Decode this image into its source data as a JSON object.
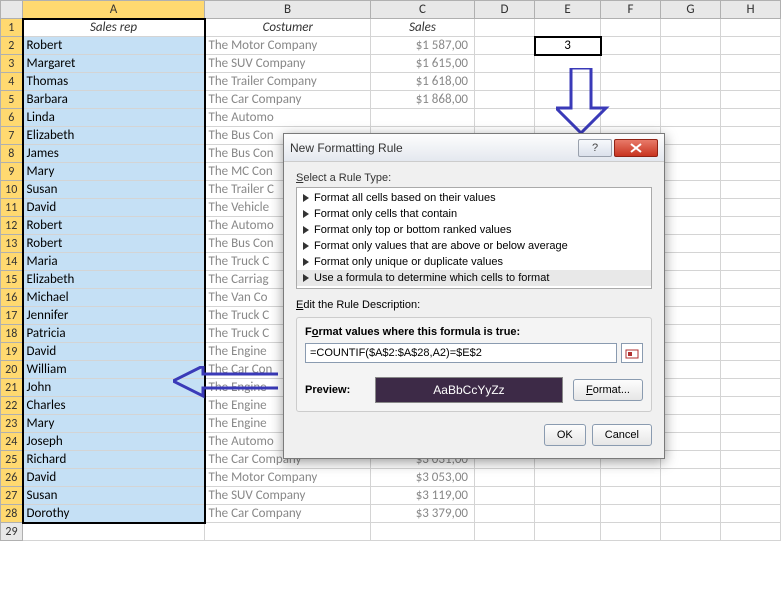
{
  "columns": [
    "A",
    "B",
    "C",
    "D",
    "E",
    "F",
    "G",
    "H"
  ],
  "headerRow": {
    "A": "Sales rep",
    "B": "Costumer",
    "C": "Sales"
  },
  "e2": "3",
  "rows": [
    {
      "n": 2,
      "A": "Robert",
      "B": "The Motor Company",
      "C": "$1 587,00"
    },
    {
      "n": 3,
      "A": "Margaret",
      "B": "The SUV Company",
      "C": "$1 615,00"
    },
    {
      "n": 4,
      "A": "Thomas",
      "B": "The Trailer Company",
      "C": "$1 618,00"
    },
    {
      "n": 5,
      "A": "Barbara",
      "B": "The Car Company",
      "C": "$1 868,00"
    },
    {
      "n": 6,
      "A": "Linda",
      "B": "The Automo",
      "C": ""
    },
    {
      "n": 7,
      "A": "Elizabeth",
      "B": "The Bus Con",
      "C": ""
    },
    {
      "n": 8,
      "A": "James",
      "B": "The Bus Con",
      "C": ""
    },
    {
      "n": 9,
      "A": "Mary",
      "B": "The MC Con",
      "C": ""
    },
    {
      "n": 10,
      "A": "Susan",
      "B": "The Trailer C",
      "C": ""
    },
    {
      "n": 11,
      "A": "David",
      "B": "The Vehicle",
      "C": ""
    },
    {
      "n": 12,
      "A": "Robert",
      "B": "The Automo",
      "C": ""
    },
    {
      "n": 13,
      "A": "Robert",
      "B": "The Bus Con",
      "C": ""
    },
    {
      "n": 14,
      "A": "Maria",
      "B": "The Truck C",
      "C": ""
    },
    {
      "n": 15,
      "A": "Elizabeth",
      "B": "The Carriag",
      "C": ""
    },
    {
      "n": 16,
      "A": "Michael",
      "B": "The Van Co",
      "C": ""
    },
    {
      "n": 17,
      "A": "Jennifer",
      "B": "The Truck C",
      "C": ""
    },
    {
      "n": 18,
      "A": "Patricia",
      "B": "The Truck C",
      "C": ""
    },
    {
      "n": 19,
      "A": "David",
      "B": "The Engine",
      "C": ""
    },
    {
      "n": 20,
      "A": "William",
      "B": "The Car Con",
      "C": ""
    },
    {
      "n": 21,
      "A": "John",
      "B": "The Engine",
      "C": ""
    },
    {
      "n": 22,
      "A": "Charles",
      "B": "The Engine",
      "C": ""
    },
    {
      "n": 23,
      "A": "Mary",
      "B": "The Engine",
      "C": ""
    },
    {
      "n": 24,
      "A": "Joseph",
      "B": "The Automo",
      "C": ""
    },
    {
      "n": 25,
      "A": "Richard",
      "B": "The Car Company",
      "C": "$3 031,00"
    },
    {
      "n": 26,
      "A": "David",
      "B": "The Motor Company",
      "C": "$3 053,00"
    },
    {
      "n": 27,
      "A": "Susan",
      "B": "The SUV Company",
      "C": "$3 119,00"
    },
    {
      "n": 28,
      "A": "Dorothy",
      "B": "The Car Company",
      "C": "$3 379,00"
    }
  ],
  "dialog": {
    "title": "New Formatting Rule",
    "selectRuleLabel": "Select a Rule Type:",
    "ruleTypes": [
      "Format all cells based on their values",
      "Format only cells that contain",
      "Format only top or bottom ranked values",
      "Format only values that are above or below average",
      "Format only unique or duplicate values",
      "Use a formula to determine which cells to format"
    ],
    "editDescLabel": "Edit the Rule Description:",
    "formulaLabel": "Format values where this formula is true:",
    "formulaValue": "=COUNTIF($A$2:$A$28,A2)=$E$2",
    "previewLabel": "Preview:",
    "previewText": "AaBbCcYyZz",
    "formatBtn": "Format...",
    "okBtn": "OK",
    "cancelBtn": "Cancel"
  }
}
